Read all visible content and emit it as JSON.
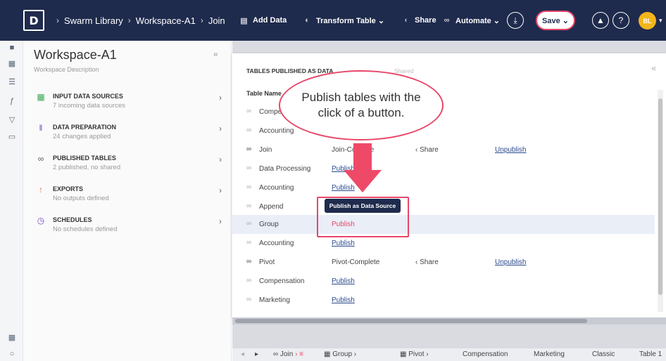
{
  "topbar": {
    "logo": "D",
    "breadcrumb": [
      "Swarm Library",
      "Workspace-A1",
      "Join"
    ],
    "add_data": "Add Data",
    "transform_table": "Transform Table ⌄",
    "share": "Share",
    "automate": "Automate ⌄",
    "save": "Save ⌄",
    "avatar_initials": "BL",
    "colors": {
      "bar": "#1f2b4d",
      "accent": "#e8476a",
      "avatar": "#f2b51c"
    }
  },
  "rail": {
    "icons": [
      "binoculars-icon",
      "table-icon",
      "list-icon",
      "formula-icon",
      "filter-icon",
      "comment-icon",
      "table-settings-icon",
      "lightbulb-icon"
    ]
  },
  "left_panel": {
    "title": "Workspace-A1",
    "description": "Workspace Description",
    "sections": [
      {
        "title": "INPUT DATA SOURCES",
        "subtitle": "7 incoming data sources",
        "icon": "grid-icon"
      },
      {
        "title": "DATA PREPARATION",
        "subtitle": "24 changes applied",
        "icon": "sliders-icon"
      },
      {
        "title": "PUBLISHED TABLES",
        "subtitle": "2 published, no shared",
        "icon": "link-icon"
      },
      {
        "title": "EXPORTS",
        "subtitle": "No outputs defined",
        "icon": "upload-icon"
      },
      {
        "title": "SCHEDULES",
        "subtitle": "No schedules defined",
        "icon": "timer-icon"
      }
    ]
  },
  "main": {
    "heading": "TABLES PUBLISHED AS DATA",
    "heading_tail": "Shared",
    "column_table_name": "Table Name",
    "rows": [
      {
        "name": "Compen",
        "status": "",
        "share": "",
        "unpublish": ""
      },
      {
        "name": "Accounting",
        "status": "",
        "share": "",
        "unpublish": ""
      },
      {
        "name": "Join",
        "status": "Join-Co",
        "status_tail": "te",
        "share": "Share",
        "unpublish": "Unpublish"
      },
      {
        "name": "Data Processing",
        "status": "Publish",
        "share": "",
        "unpublish": ""
      },
      {
        "name": "Accounting",
        "status": "Publish",
        "share": "",
        "unpublish": ""
      },
      {
        "name": "Append",
        "status": "",
        "share": "",
        "unpublish": ""
      },
      {
        "name": "Group",
        "status": "Publish",
        "share": "",
        "unpublish": ""
      },
      {
        "name": "Accounting",
        "status": "Publish",
        "share": "",
        "unpublish": ""
      },
      {
        "name": "Pivot",
        "status": "Pivot-Complete",
        "share": "Share",
        "unpublish": "Unpublish"
      },
      {
        "name": "Compensation",
        "status": "Publish",
        "share": "",
        "unpublish": ""
      },
      {
        "name": "Marketing",
        "status": "Publish",
        "share": "",
        "unpublish": ""
      }
    ],
    "tooltip": "Publish as Data Source",
    "callout": "Publish tables with the click of a button."
  },
  "tabs": [
    "Join",
    "Group",
    "Pivot",
    "Compensation",
    "Marketing",
    "Classic",
    "Table 1"
  ]
}
